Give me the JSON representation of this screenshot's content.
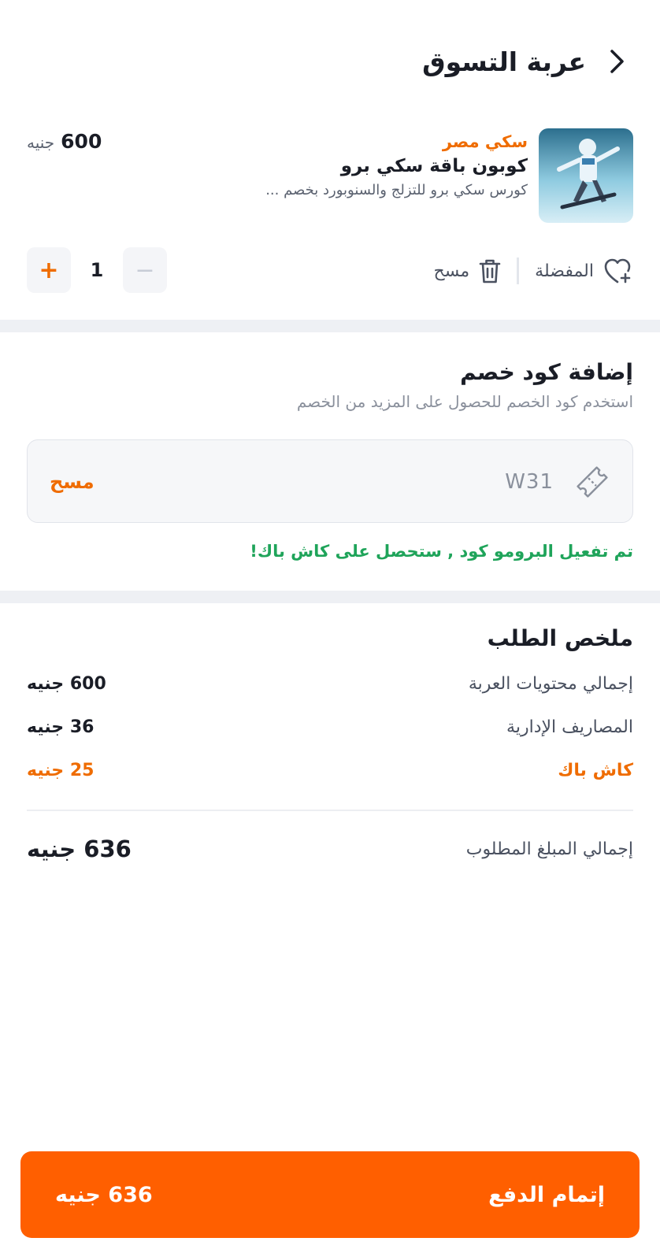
{
  "header": {
    "title": "عربة التسوق"
  },
  "cart_item": {
    "vendor": "سكي مصر",
    "name": "كوبون باقة سكي برو",
    "description": "كورس سكي برو للتزلج والسنوبورد بخصم ...",
    "price": "600",
    "currency": "جنيه",
    "quantity": "1",
    "minus_label": "−",
    "plus_label": "+",
    "favorite_label": "المفضلة",
    "delete_label": "مسح"
  },
  "discount": {
    "title": "إضافة كود خصم",
    "subtitle": "استخدم كود الخصم للحصول على المزيد من الخصم",
    "code_value": "W31",
    "clear_label": "مسح",
    "success_message": "تم تفعيل البرومو كود ,  ستحصل على كاش باك!"
  },
  "summary": {
    "title": "ملخص الطلب",
    "rows": [
      {
        "label": "إجمالي محتويات العربة",
        "value": "600 جنيه"
      },
      {
        "label": "المصاريف الإدارية",
        "value": "36 جنيه"
      },
      {
        "label": "كاش باك",
        "value": "25 جنيه"
      }
    ],
    "total_label": "إجمالي المبلغ المطلوب",
    "total_value": "636 جنيه"
  },
  "pay_button": {
    "label": "إتمام الدفع",
    "amount": "636 جنيه"
  },
  "colors": {
    "accent": "#ff5f00",
    "vendor": "#ef6c00",
    "success": "#1fa45a"
  }
}
